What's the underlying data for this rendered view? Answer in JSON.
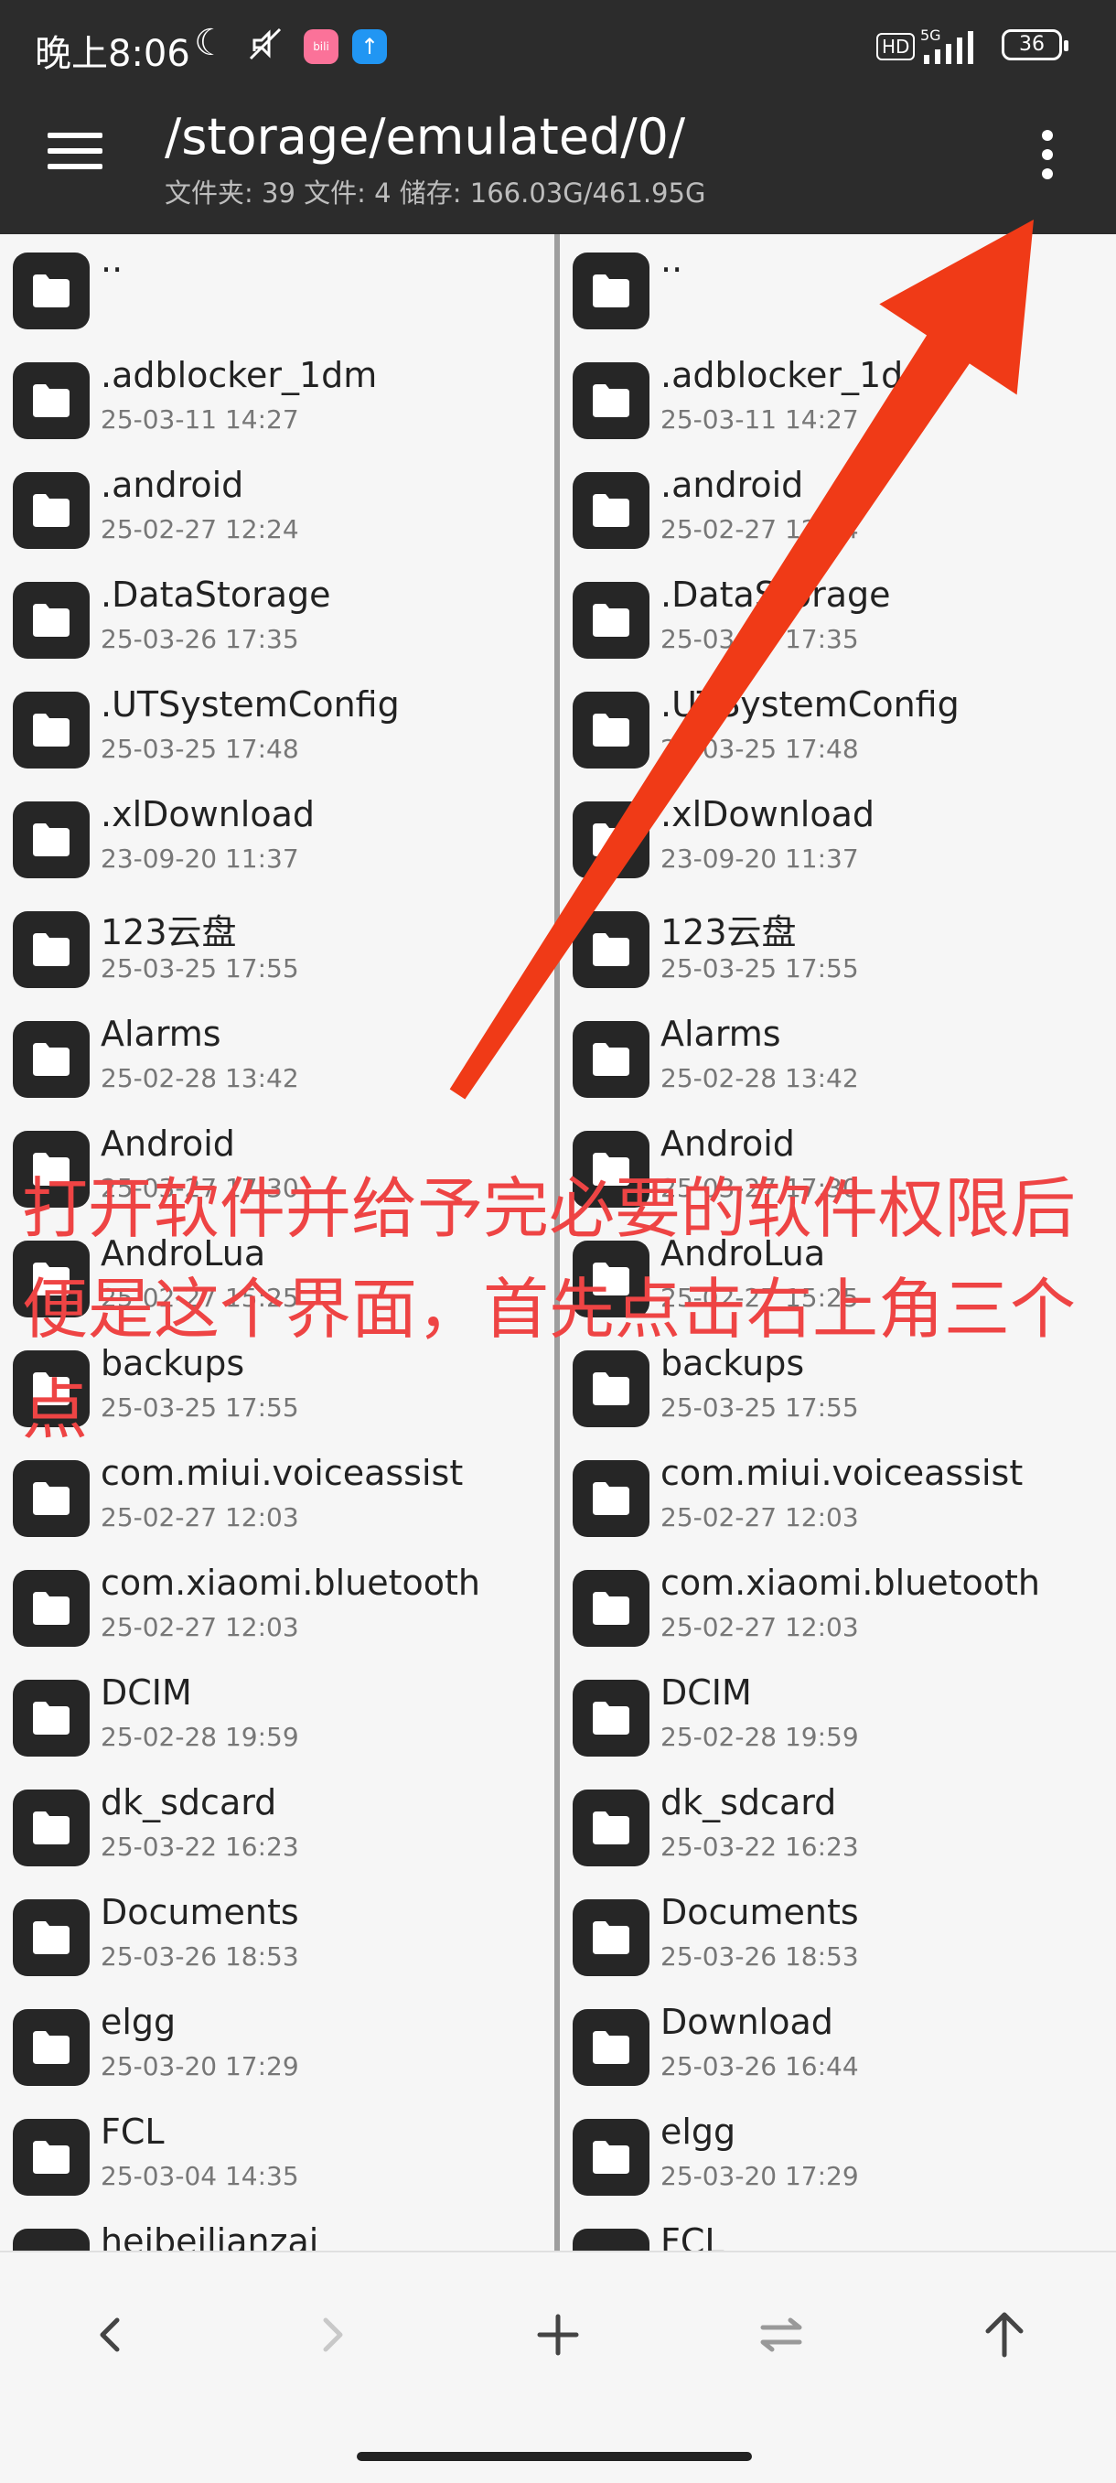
{
  "status_bar": {
    "time": "晚上8:06",
    "network": "5G",
    "hd": "HD",
    "battery": "36"
  },
  "toolbar": {
    "path": "/storage/emulated/0/",
    "info": "文件夹: 39   文件: 4   储存: 166.03G/461.95G"
  },
  "left_pane": {
    "items": [
      {
        "name": "..",
        "date": ""
      },
      {
        "name": ".adblocker_1dm",
        "date": "25-03-11 14:27"
      },
      {
        "name": ".android",
        "date": "25-02-27 12:24"
      },
      {
        "name": ".DataStorage",
        "date": "25-03-26 17:35"
      },
      {
        "name": ".UTSystemConfig",
        "date": "25-03-25 17:48"
      },
      {
        "name": ".xlDownload",
        "date": "23-09-20 11:37"
      },
      {
        "name": "123云盘",
        "date": "25-03-25 17:55"
      },
      {
        "name": "Alarms",
        "date": "25-02-28 13:42"
      },
      {
        "name": "Android",
        "date": "25-03-27 17:30"
      },
      {
        "name": "AndroLua",
        "date": "25-02-27 15:25"
      },
      {
        "name": "backups",
        "date": "25-03-25 17:55"
      },
      {
        "name": "com.miui.voiceassist",
        "date": "25-02-27 12:03"
      },
      {
        "name": "com.xiaomi.bluetooth",
        "date": "25-02-27 12:03"
      },
      {
        "name": "DCIM",
        "date": "25-02-28 19:59"
      },
      {
        "name": "dk_sdcard",
        "date": "25-03-22 16:23"
      },
      {
        "name": "Documents",
        "date": "25-03-26 18:53"
      },
      {
        "name": "elgg",
        "date": "25-03-20 17:29"
      },
      {
        "name": "FCL",
        "date": "25-03-04 14:35"
      },
      {
        "name": "heibeilianzai",
        "date": ""
      }
    ]
  },
  "right_pane": {
    "items": [
      {
        "name": "..",
        "date": ""
      },
      {
        "name": ".adblocker_1dm",
        "date": "25-03-11 14:27"
      },
      {
        "name": ".android",
        "date": "25-02-27 12:24"
      },
      {
        "name": ".DataStorage",
        "date": "25-03-26 17:35"
      },
      {
        "name": ".UTSystemConfig",
        "date": "25-03-25 17:48"
      },
      {
        "name": ".xlDownload",
        "date": "23-09-20 11:37"
      },
      {
        "name": "123云盘",
        "date": "25-03-25 17:55"
      },
      {
        "name": "Alarms",
        "date": "25-02-28 13:42"
      },
      {
        "name": "Android",
        "date": "25-03-27 17:30"
      },
      {
        "name": "AndroLua",
        "date": "25-02-27 15:25"
      },
      {
        "name": "backups",
        "date": "25-03-25 17:55"
      },
      {
        "name": "com.miui.voiceassist",
        "date": "25-02-27 12:03"
      },
      {
        "name": "com.xiaomi.bluetooth",
        "date": "25-02-27 12:03"
      },
      {
        "name": "DCIM",
        "date": "25-02-28 19:59"
      },
      {
        "name": "dk_sdcard",
        "date": "25-03-22 16:23"
      },
      {
        "name": "Documents",
        "date": "25-03-26 18:53"
      },
      {
        "name": "Download",
        "date": "25-03-26 16:44"
      },
      {
        "name": "elgg",
        "date": "25-03-20 17:29"
      },
      {
        "name": "FCL",
        "date": ""
      }
    ]
  },
  "annotation": {
    "text": "打开软件并给予完必要的软件权限后便是这个界面，首先点击右上角三个点",
    "color": "#ee4444",
    "arrow_color": "#f03a17"
  },
  "colors": {
    "toolbar_bg": "#2c2c2c",
    "folder_icon_bg": "#262626"
  }
}
